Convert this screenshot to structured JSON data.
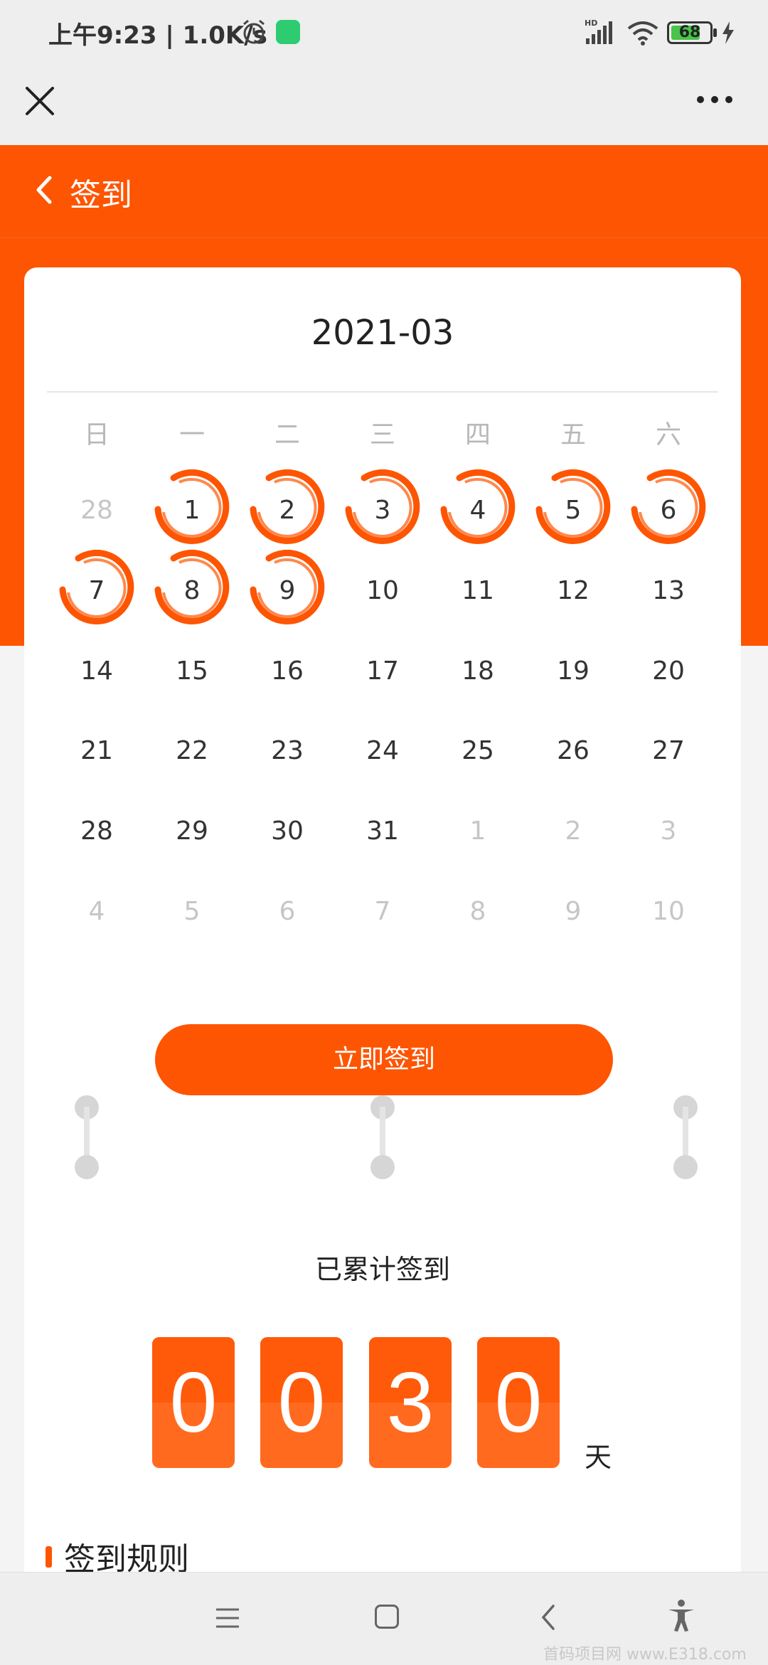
{
  "status_bar": {
    "time_speed": "上午9:23 | 1.0K/s",
    "battery": "68",
    "network": "HD"
  },
  "header": {
    "title": "签到"
  },
  "calendar": {
    "month": "2021-03",
    "weekdays": [
      "日",
      "一",
      "二",
      "三",
      "四",
      "五",
      "六"
    ],
    "weeks": [
      [
        "28",
        "1",
        "2",
        "3",
        "4",
        "5",
        "6"
      ],
      [
        "7",
        "8",
        "9",
        "10",
        "11",
        "12",
        "13"
      ],
      [
        "14",
        "15",
        "16",
        "17",
        "18",
        "19",
        "20"
      ],
      [
        "21",
        "22",
        "23",
        "24",
        "25",
        "26",
        "27"
      ],
      [
        "28",
        "29",
        "30",
        "31",
        "1",
        "2",
        "3"
      ],
      [
        "4",
        "5",
        "6",
        "7",
        "8",
        "9",
        "10"
      ]
    ],
    "signed_days": [
      "1",
      "2",
      "3",
      "4",
      "5",
      "6",
      "7",
      "8",
      "9"
    ]
  },
  "sign_button": {
    "label": "立即签到"
  },
  "total": {
    "label": "已累计签到",
    "digits": [
      "0",
      "0",
      "3",
      "0"
    ],
    "unit": "天"
  },
  "rules": {
    "title": "签到规则"
  },
  "watermark": "首码项目网 www.E318.com",
  "colors": {
    "accent": "#fe5502",
    "other_month": "#c6c6c6"
  }
}
